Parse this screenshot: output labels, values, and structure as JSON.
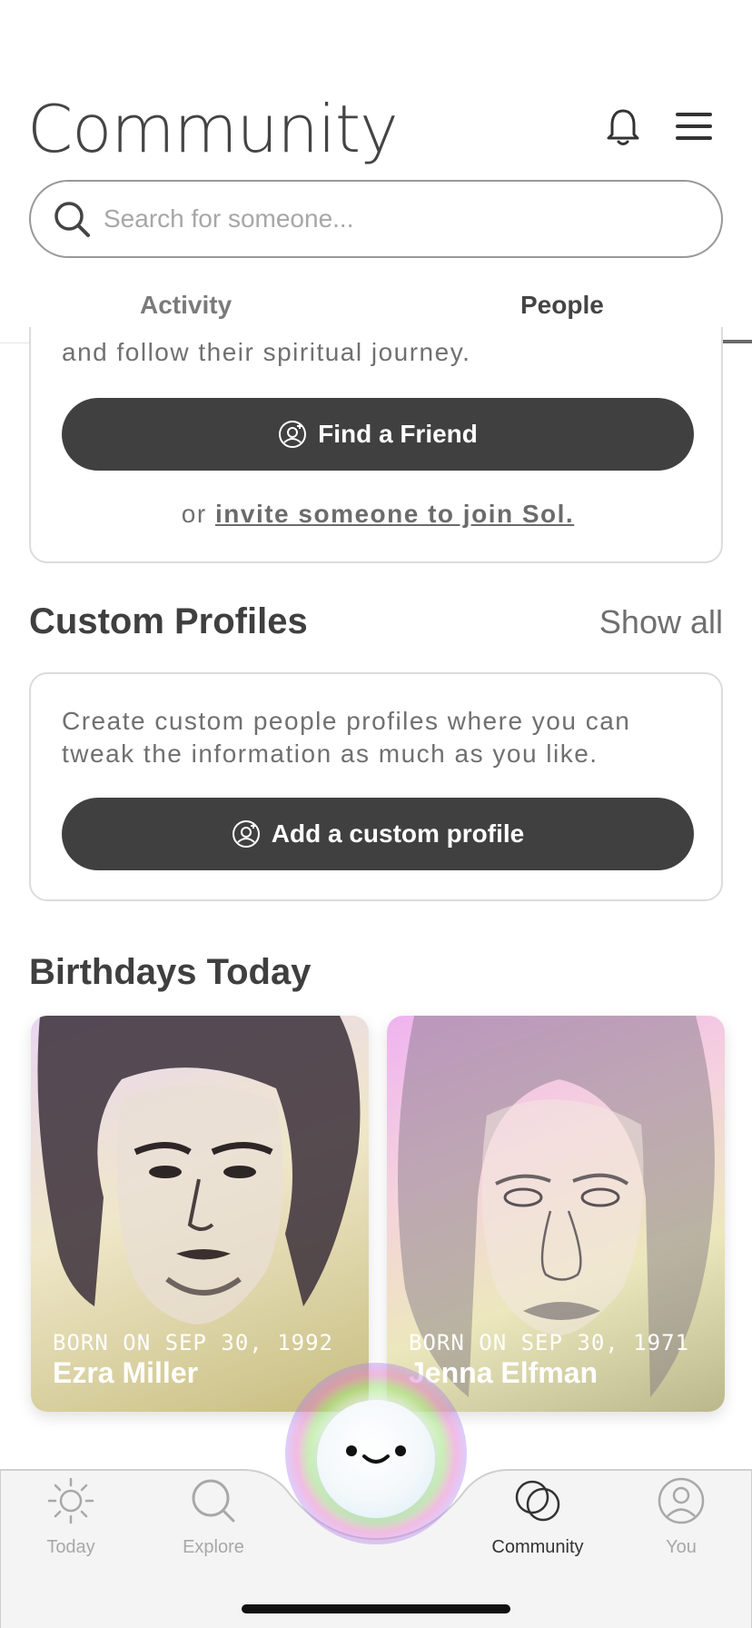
{
  "header": {
    "title": "Community"
  },
  "search": {
    "placeholder": "Search for someone..."
  },
  "tabs": [
    {
      "label": "Activity"
    },
    {
      "label": "People"
    }
  ],
  "friends_card": {
    "partial_text": "and follow their spiritual journey.",
    "button_label": "Find a Friend",
    "invite_prefix": "or ",
    "invite_link": "invite someone to join Sol."
  },
  "custom_profiles": {
    "title": "Custom Profiles",
    "show_all": "Show all",
    "description": "Create custom people profiles where you can tweak the information as much as you like.",
    "button_label": "Add a custom profile"
  },
  "birthdays": {
    "title": "Birthdays Today",
    "people": [
      {
        "born": "BORN ON SEP 30, 1992",
        "name": "Ezra Miller"
      },
      {
        "born": "BORN ON SEP 30, 1971",
        "name": "Jenna Elfman"
      }
    ]
  },
  "tabbar": {
    "items": [
      {
        "label": "Today",
        "icon": "sun-icon"
      },
      {
        "label": "Explore",
        "icon": "search-icon"
      },
      {
        "label": "Community",
        "icon": "overlapping-circles-icon",
        "active": true
      },
      {
        "label": "You",
        "icon": "person-icon"
      }
    ]
  }
}
